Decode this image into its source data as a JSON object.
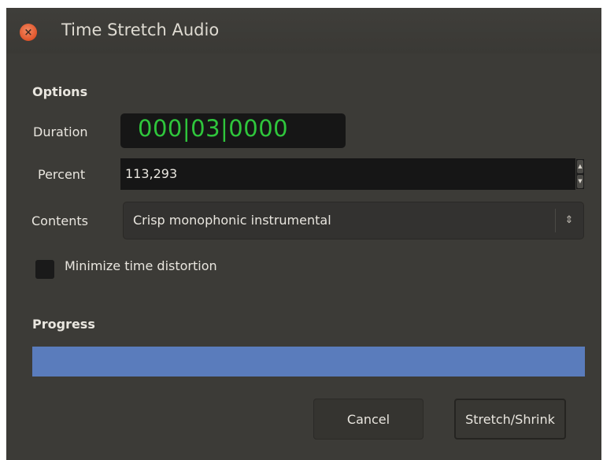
{
  "window": {
    "title": "Time Stretch Audio",
    "close_symbol": "×"
  },
  "options": {
    "heading": "Options",
    "duration_label": "Duration",
    "duration_value": "000|03|0000",
    "percent_label": "Percent",
    "percent_value": "113,293",
    "contents_label": "Contents",
    "contents_value": "Crisp monophonic instrumental",
    "minimize_label": "Minimize time distortion",
    "minimize_checked": false
  },
  "progress": {
    "heading": "Progress",
    "fraction": 1.0
  },
  "buttons": {
    "cancel": "Cancel",
    "stretch": "Stretch/Shrink"
  },
  "colors": {
    "background": "#3c3b37",
    "duration_digits": "#2fc63c",
    "progress_fill": "#5a7cbc",
    "close_button": "#e0542a"
  },
  "icons": {
    "close": "close-icon",
    "spin_up": "spin-up-icon",
    "spin_down": "spin-down-icon",
    "combo": "combo-updown-icon"
  }
}
